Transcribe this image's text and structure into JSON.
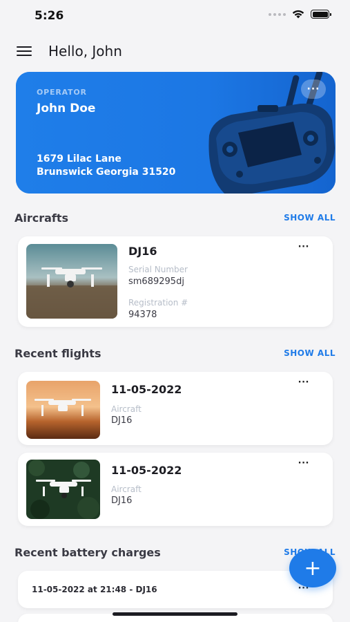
{
  "status_bar": {
    "time": "5:26"
  },
  "header": {
    "greeting": "Hello, John"
  },
  "operator": {
    "label": "OPERATOR",
    "name": "John Doe",
    "address_line1": "1679 Lilac Lane",
    "address_line2": "Brunswick Georgia 31520",
    "more": "···"
  },
  "aircrafts": {
    "title": "Aircrafts",
    "show_all": "SHOW ALL",
    "items": [
      {
        "name": "DJ16",
        "serial_label": "Serial Number",
        "serial": "sm689295dj",
        "registration_label": "Registration #",
        "registration": "94378",
        "more": "···"
      }
    ]
  },
  "recent_flights": {
    "title": "Recent flights",
    "show_all": "SHOW ALL",
    "items": [
      {
        "date": "11-05-2022",
        "aircraft_label": "Aircraft",
        "aircraft": "DJ16",
        "more": "···"
      },
      {
        "date": "11-05-2022",
        "aircraft_label": "Aircraft",
        "aircraft": "DJ16",
        "more": "···"
      }
    ]
  },
  "battery_charges": {
    "title": "Recent battery charges",
    "show_all": "SHOW ALL",
    "items": [
      {
        "text": "11-05-2022 at 21:48 - DJ16",
        "more": "···"
      }
    ]
  },
  "fab": {
    "label": "+"
  },
  "colors": {
    "accent": "#1f7be8",
    "background": "#f4f4f6",
    "card": "#ffffff"
  }
}
